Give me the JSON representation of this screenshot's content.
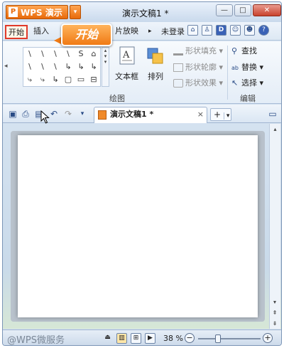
{
  "app": {
    "name": "WPS 演示",
    "logo_letter": "P",
    "document_title": "演示文稿1 *"
  },
  "window_controls": {
    "minimize": "—",
    "restore": "□",
    "close": "✕"
  },
  "tabs": [
    {
      "label": "开始",
      "highlighted": true
    },
    {
      "label": "插入"
    },
    {
      "label": "片放映"
    }
  ],
  "tab_scroll": "▸",
  "callout": {
    "text": "开始",
    "color": "#f07a14"
  },
  "topright": {
    "login": "未登录",
    "icons": [
      "window-icon",
      "shirt-icon",
      "d-icon",
      "users-icon",
      "smile-icon",
      "help-icon"
    ]
  },
  "ribbon": {
    "shapes_glyphs": [
      "\\",
      "\\",
      "\\",
      "\\",
      "S",
      "⌂",
      "\\",
      "\\",
      "\\",
      "↳",
      "↳",
      "↳",
      "⤷",
      "⤷",
      "↳",
      "▢",
      "▭",
      "⊟"
    ],
    "textbox": "文本框",
    "arrange": "排列",
    "shape_fill": "形状填充",
    "shape_outline": "形状轮廓",
    "shape_effect": "形状效果",
    "group_drawing": "绘图",
    "find": "查找",
    "replace": "替换",
    "select": "选择",
    "group_edit": "编辑"
  },
  "doc_tabs": {
    "tab_label": "演示文稿1 *",
    "close": "×",
    "new_tab": "+",
    "new_tab_menu": "▾"
  },
  "status": {
    "watermark": "@WPS微服务",
    "zoom": "38 %",
    "zoom_out": "−",
    "zoom_in": "+",
    "zoom_level": 0.38
  }
}
